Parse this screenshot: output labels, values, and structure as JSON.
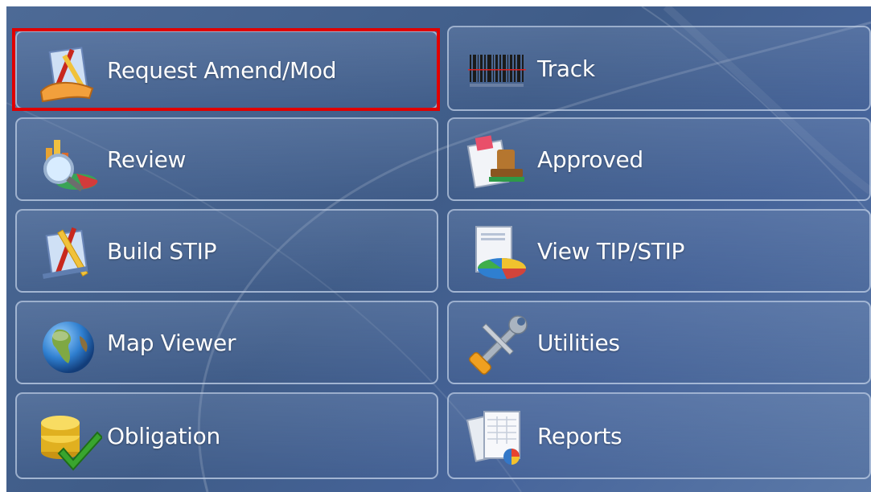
{
  "menu": {
    "left": [
      {
        "label": "Request Amend/Mod",
        "icon": "pencil-ruler-hand-icon"
      },
      {
        "label": "Review",
        "icon": "magnifier-chart-icon"
      },
      {
        "label": "Build STIP",
        "icon": "pencil-ruler-icon"
      },
      {
        "label": "Map Viewer",
        "icon": "globe-icon"
      },
      {
        "label": "Obligation",
        "icon": "coins-checkmark-icon"
      }
    ],
    "right": [
      {
        "label": "Track",
        "icon": "barcode-icon"
      },
      {
        "label": "Approved",
        "icon": "stamp-icon"
      },
      {
        "label": "View TIP/STIP",
        "icon": "pie-chart-document-icon"
      },
      {
        "label": "Utilities",
        "icon": "wrench-screwdriver-icon"
      },
      {
        "label": "Reports",
        "icon": "report-documents-icon"
      }
    ]
  },
  "selected": "Request Amend/Mod",
  "colors": {
    "background": "#46649a",
    "tile_border": "#cddaee",
    "highlight": "#e00000",
    "text": "#ffffff"
  }
}
